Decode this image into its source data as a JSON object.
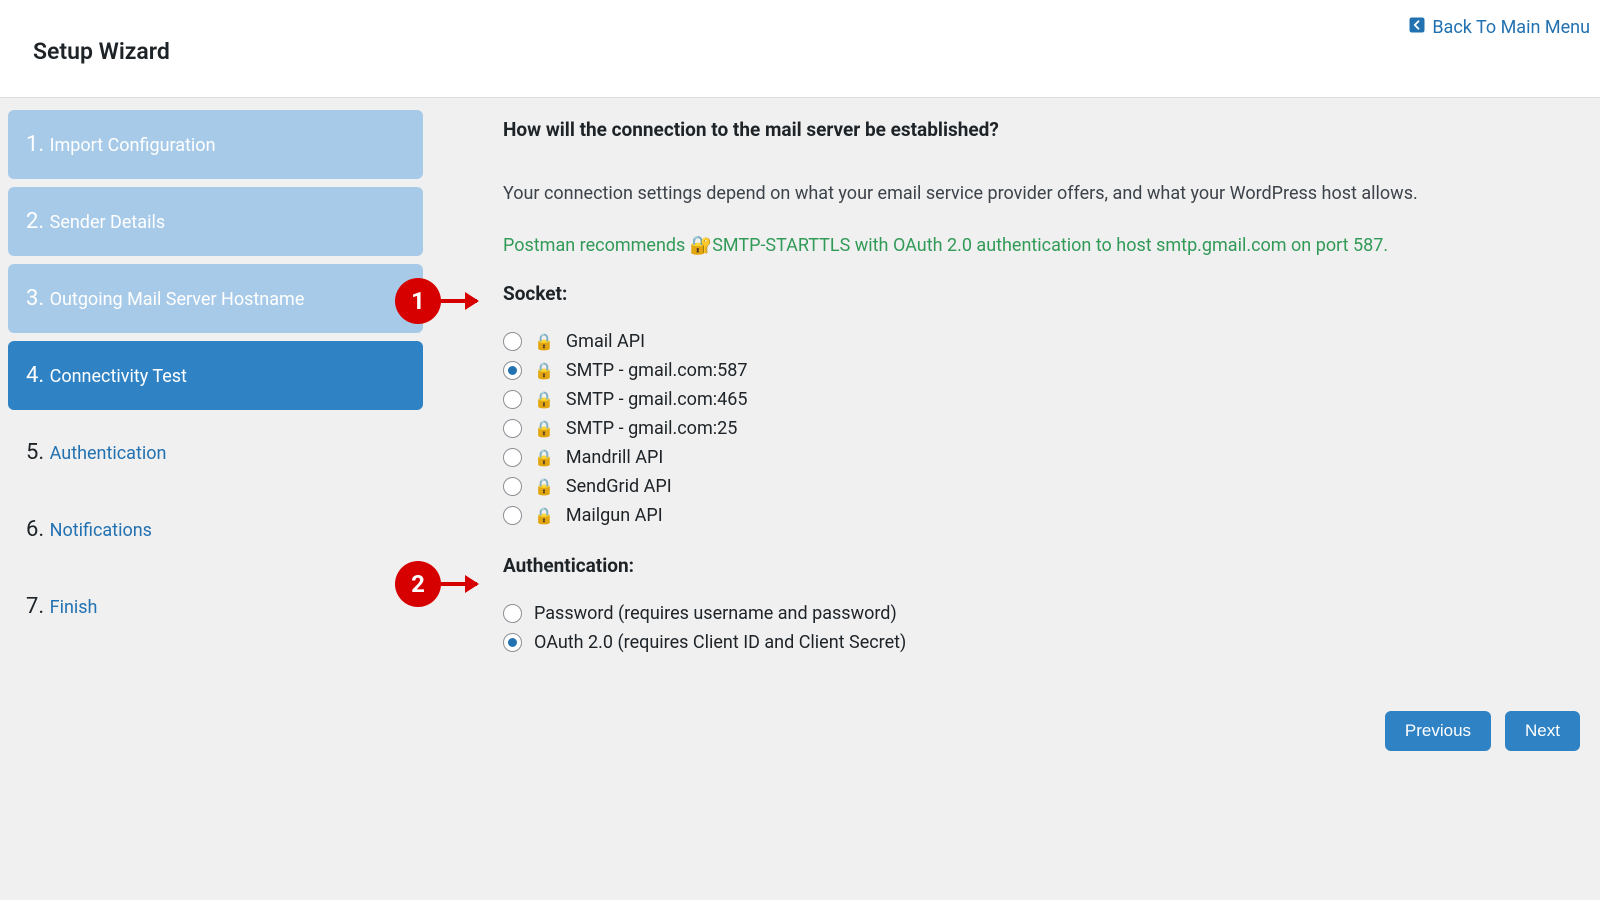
{
  "header": {
    "back_label": "Back To Main Menu",
    "title": "Setup Wizard"
  },
  "sidebar": {
    "steps": [
      {
        "num": "1.",
        "label": "Import Configuration",
        "state": "completed"
      },
      {
        "num": "2.",
        "label": "Sender Details",
        "state": "completed"
      },
      {
        "num": "3.",
        "label": "Outgoing Mail Server Hostname",
        "state": "completed"
      },
      {
        "num": "4.",
        "label": "Connectivity Test",
        "state": "active"
      },
      {
        "num": "5.",
        "label": "Authentication",
        "state": "upcoming"
      },
      {
        "num": "6.",
        "label": "Notifications",
        "state": "upcoming"
      },
      {
        "num": "7.",
        "label": "Finish",
        "state": "upcoming"
      }
    ]
  },
  "main": {
    "heading": "How will the connection to the mail server be established?",
    "lead": "Your connection settings depend on what your email service provider offers, and what your WordPress host allows.",
    "recommend_prefix": "Postman recommends ",
    "recommend_link": "SMTP-STARTTLS with OAuth 2.0 authentication to host smtp.gmail.com on port 587.",
    "socket_label": "Socket:",
    "socket_options": [
      {
        "label": "Gmail API",
        "checked": false,
        "lock": true
      },
      {
        "label": "SMTP - gmail.com:587",
        "checked": true,
        "lock": true
      },
      {
        "label": "SMTP - gmail.com:465",
        "checked": false,
        "lock": true
      },
      {
        "label": "SMTP - gmail.com:25",
        "checked": false,
        "lock": true
      },
      {
        "label": "Mandrill API",
        "checked": false,
        "lock": true
      },
      {
        "label": "SendGrid API",
        "checked": false,
        "lock": true
      },
      {
        "label": "Mailgun API",
        "checked": false,
        "lock": true
      }
    ],
    "auth_label": "Authentication:",
    "auth_options": [
      {
        "label": "Password (requires username and password)",
        "checked": false
      },
      {
        "label": "OAuth 2.0 (requires Client ID and Client Secret)",
        "checked": true
      }
    ]
  },
  "footer": {
    "prev": "Previous",
    "next": "Next"
  },
  "callouts": {
    "c1": "1",
    "c2": "2"
  }
}
